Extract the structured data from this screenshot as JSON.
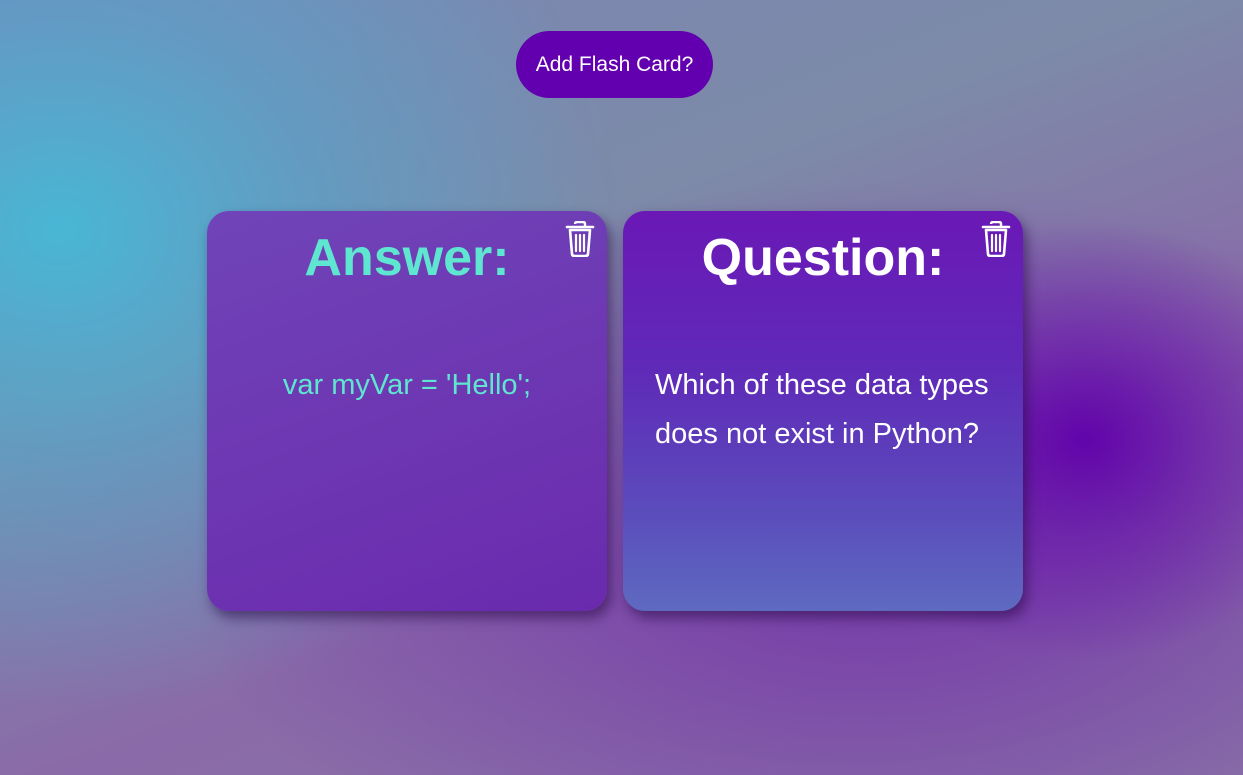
{
  "toolbar": {
    "add_label": "Add Flash Card?"
  },
  "cards": [
    {
      "side": "answer",
      "title": "Answer:",
      "text": "var myVar = 'Hello';",
      "delete_icon": "trash-icon"
    },
    {
      "side": "question",
      "title": "Question:",
      "text": "Which of these data types does not exist in Python?",
      "delete_icon": "trash-icon"
    }
  ],
  "colors": {
    "button_bg": "#6200b0",
    "answer_text": "#5fe6d0",
    "question_text": "#ffffff"
  }
}
